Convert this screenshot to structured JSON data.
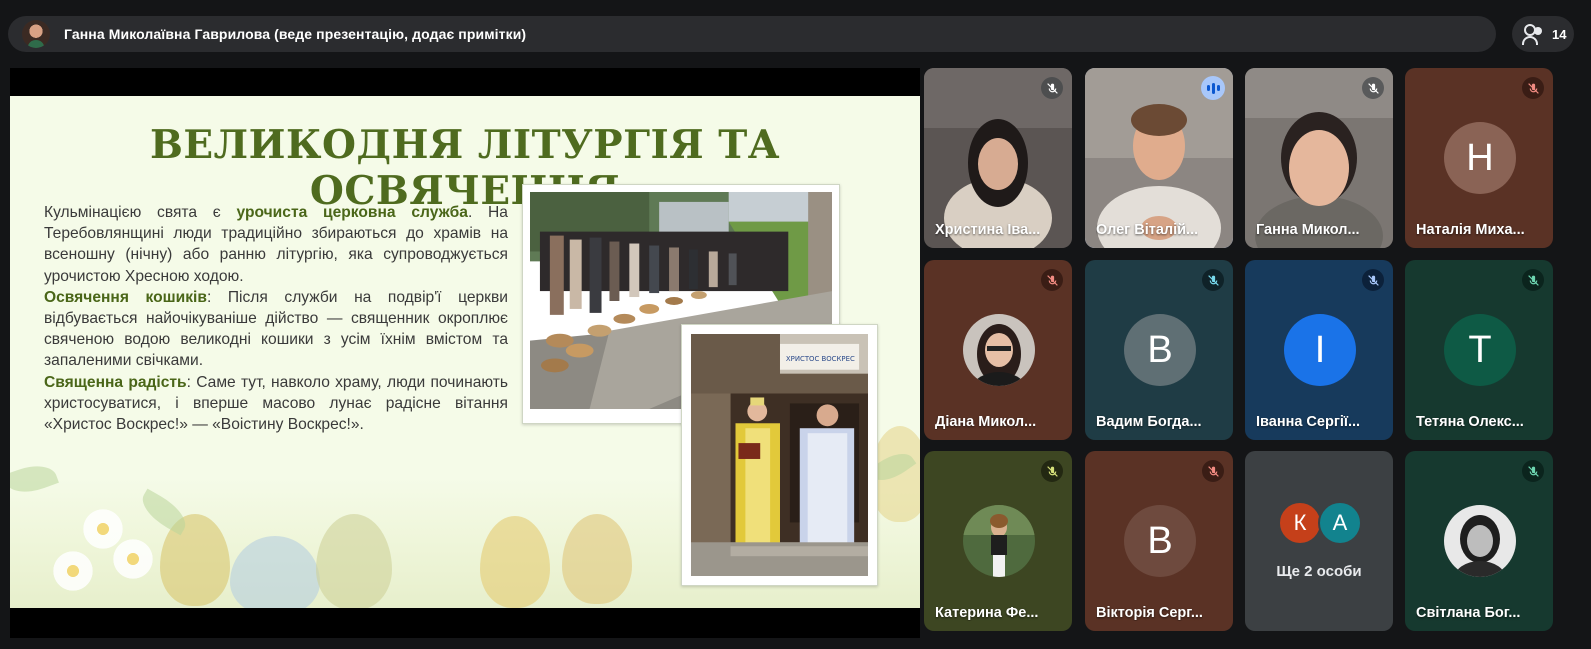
{
  "header": {
    "presenter_text": "Ганна Миколаївна Гаврилова (веде презентацію, додає примітки)",
    "participant_count": "14"
  },
  "slide": {
    "title": "ВЕЛИКОДНЯ ЛІТУРГІЯ ТА ОСВЯЧЕННЯ",
    "p1_a": "Кульмінацією свята є ",
    "p1_b": "урочиста церковна служба",
    "p1_c": ". На Теребовлянщині люди традиційно збираються до храмів на всеношну (нічну) або ранню літургію, яка супроводжується урочистою Хресною ходою.",
    "p2_a": "Освячення кошиків",
    "p2_b": ": Після служби на подвір'ї церкви відбувається найочікуваніше дійство — священник окроплює свяченою водою великодні кошики з усім їхнім вмістом та запаленими свічками.",
    "p3_a": "Священна радість",
    "p3_b": ": Саме тут, навколо храму, люди починають христосуватися, і вперше масово лунає радісне вітання «Христос Воскрес!» — «Воістину Воскрес!».",
    "banner_text": "ХРИСТОС ВОСКРЕС"
  },
  "tiles": [
    {
      "name": "Христина Іва...",
      "mic": "muted",
      "kind": "video"
    },
    {
      "name": "Олег Віталій...",
      "mic": "speaking",
      "kind": "video"
    },
    {
      "name": "Ганна Микол...",
      "mic": "muted",
      "kind": "video"
    },
    {
      "name": "Наталія Миха...",
      "mic": "muted",
      "kind": "letter",
      "letter": "Н"
    },
    {
      "name": "Діана Микол...",
      "mic": "muted",
      "kind": "photo"
    },
    {
      "name": "Вадим Богда...",
      "mic": "muted",
      "kind": "letter",
      "letter": "В"
    },
    {
      "name": "Іванна Сергії...",
      "mic": "muted",
      "kind": "letter",
      "letter": "І"
    },
    {
      "name": "Тетяна Олекс...",
      "mic": "muted",
      "kind": "letter",
      "letter": "Т"
    },
    {
      "name": "Катерина Фе...",
      "mic": "muted",
      "kind": "photo"
    },
    {
      "name": "Вікторія Серг...",
      "mic": "muted",
      "kind": "letter",
      "letter": "В"
    },
    {
      "name": "Ще 2 особи",
      "kind": "more",
      "letters": [
        "К",
        "А"
      ]
    },
    {
      "name": "Світлана Бог...",
      "mic": "muted",
      "kind": "photo"
    }
  ],
  "colors": {
    "slide_title": "#4f6b1f",
    "tile_brown": "#5a3225",
    "tile_teal": "#1f3c45",
    "tile_blue": "#173a5c",
    "tile_green": "#16392f",
    "tile_olive": "#3d4622",
    "tile_gray": "#3c4043",
    "avatar_blue": "#1a73e8",
    "avatar_orange": "#c5401a",
    "avatar_teal": "#12838e"
  },
  "icons": {
    "mic_muted": "mic-off-icon",
    "speaking": "audio-level-icon",
    "people": "people-icon"
  }
}
